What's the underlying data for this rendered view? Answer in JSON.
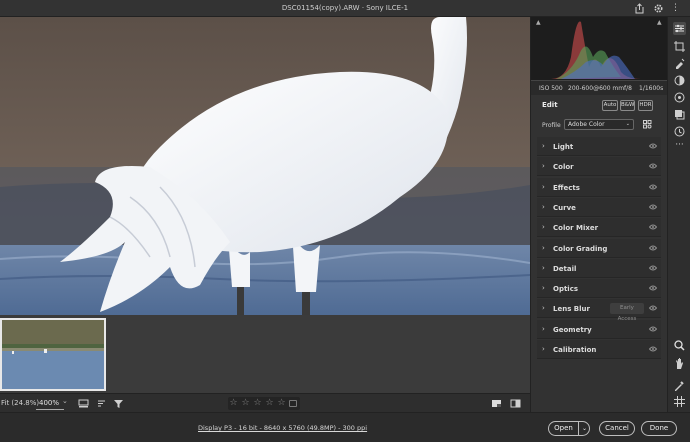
{
  "window": {
    "title": "DSC01154(copy).ARW  ·  Sony ILCE-1"
  },
  "titlebar_icons": [
    "export-icon",
    "gear-icon",
    "more-icon"
  ],
  "exif": {
    "iso": "ISO 500",
    "lens": "200-600@600 mm",
    "aperture": "f/8",
    "shutter": "1/1600s"
  },
  "edit": {
    "title": "Edit",
    "auto_label": "Auto",
    "bw_label": "B&W",
    "hdr_label": "HDR",
    "profile_label": "Profile",
    "profile_value": "Adobe Color"
  },
  "sections": [
    {
      "label": "Light"
    },
    {
      "label": "Color"
    },
    {
      "label": "Effects"
    },
    {
      "label": "Curve"
    },
    {
      "label": "Color Mixer"
    },
    {
      "label": "Color Grading"
    },
    {
      "label": "Detail"
    },
    {
      "label": "Optics"
    },
    {
      "label": "Lens Blur",
      "badge": "Early Access"
    },
    {
      "label": "Geometry"
    },
    {
      "label": "Calibration"
    }
  ],
  "bottom": {
    "fit_label": "Fit (24.8%)",
    "zoom_value": "400%",
    "rating_stars": 5,
    "rating_value": 0
  },
  "footer": {
    "info": "Display P3 - 16 bit - 8640 x 5760 (49.8MP) - 300 ppi",
    "open_label": "Open",
    "cancel_label": "Cancel",
    "done_label": "Done"
  },
  "colors": {
    "accent_panel": "#323232",
    "histogram_red": "#c44a4a",
    "histogram_green": "#5aa35a",
    "histogram_blue": "#4d6fc8"
  }
}
